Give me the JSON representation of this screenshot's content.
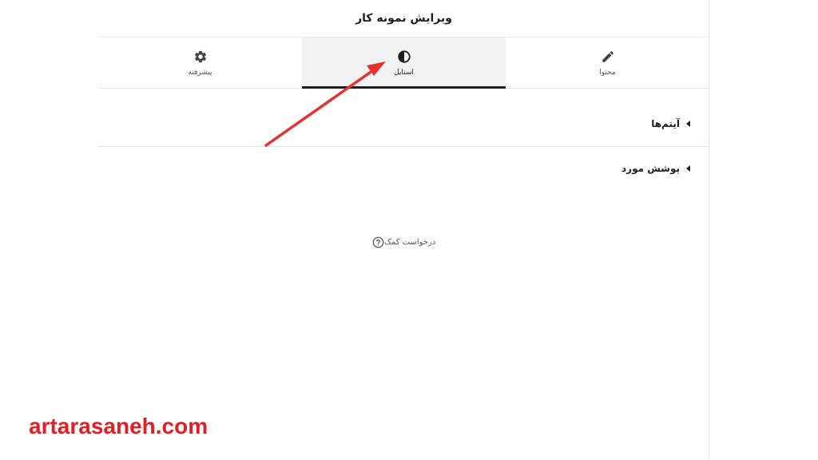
{
  "header": {
    "title": "ویرایش نمونه کار"
  },
  "tabs": [
    {
      "label": "محتوا",
      "icon": "pencil-icon",
      "active": false
    },
    {
      "label": "استایل",
      "icon": "contrast-icon",
      "active": true
    },
    {
      "label": "پیشرفته",
      "icon": "gear-icon",
      "active": false
    }
  ],
  "sections": [
    {
      "label": "آیتم‌ها",
      "icon": "caret-left-icon"
    },
    {
      "label": "پوشش مورد",
      "icon": "caret-left-icon"
    }
  ],
  "help": {
    "label": "درخواست کمک",
    "icon": "question-circle-icon"
  },
  "annotation": {
    "color": "#e8302f",
    "icon": "red-arrow"
  },
  "watermark": {
    "text": "artarasaneh.com",
    "color": "#e31e24"
  },
  "colors": {
    "active_tab_bg": "#f1f2f3",
    "active_tab_indicator": "#1e1e1e"
  }
}
